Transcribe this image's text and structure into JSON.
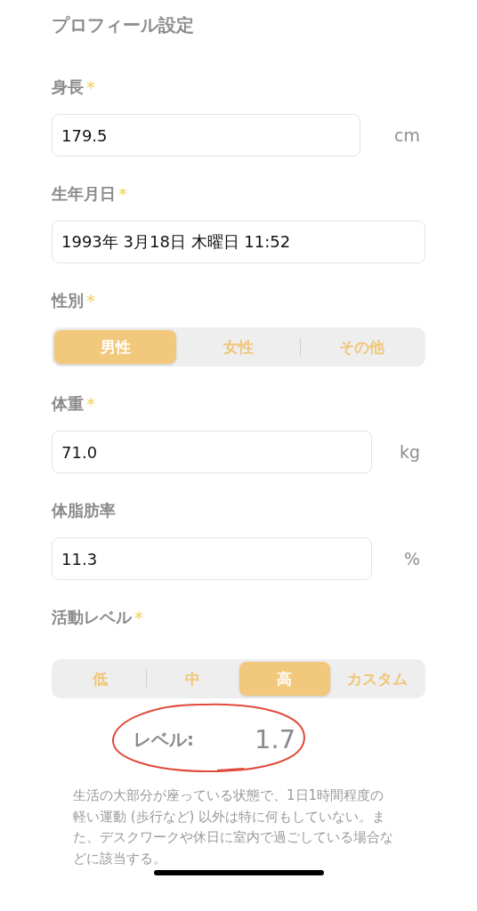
{
  "title": "プロフィール設定",
  "sections": [
    {
      "kind": "input",
      "label": "身長",
      "required_mark": "*",
      "value": "179.5",
      "unit": "cm"
    },
    {
      "kind": "input",
      "label": "生年月日",
      "required_mark": "*",
      "value": "1993年 3月18日 木曜日 11:52"
    },
    {
      "kind": "segmented",
      "label": "性別",
      "required_mark": "*",
      "options": [
        {
          "label": "男性",
          "selected": true
        },
        {
          "label": "女性",
          "selected": false
        },
        {
          "label": "その他",
          "selected": false
        }
      ]
    },
    {
      "kind": "input",
      "label": "体重",
      "required_mark": "*",
      "value": "71.0",
      "unit": "kg"
    },
    {
      "kind": "input",
      "label": "体脂肪率",
      "value": "11.3",
      "unit": "%"
    },
    {
      "kind": "segmented",
      "label": "活動レベル",
      "required_mark": "*",
      "options": [
        {
          "label": "低",
          "selected": false
        },
        {
          "label": "中",
          "selected": false
        },
        {
          "label": "高",
          "selected": true
        },
        {
          "label": "カスタム",
          "selected": false
        }
      ]
    }
  ],
  "level": {
    "label": "レベル:",
    "value": "1.7"
  },
  "description": "生活の大部分が座っている状態で、1日1時間程度の軽い運動 (歩行など) 以外は特に何もしていない。また、デスクワークや休日に室内で過ごしている場合などに該当する。"
}
